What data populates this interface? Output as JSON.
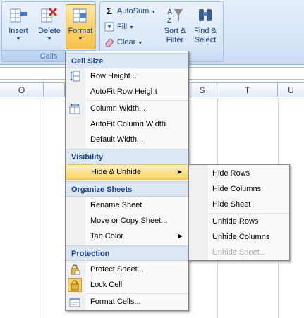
{
  "ribbon": {
    "cells_group": {
      "label": "Cells",
      "insert_label": "Insert",
      "delete_label": "Delete",
      "format_label": "Format"
    },
    "editing_group": {
      "autosum_label": "AutoSum",
      "fill_label": "Fill",
      "clear_label": "Clear",
      "sort_label_1": "Sort &",
      "sort_label_2": "Filter",
      "find_label_1": "Find &",
      "find_label_2": "Select"
    }
  },
  "columns": [
    "O",
    "S",
    "T",
    "U"
  ],
  "format_menu": {
    "sections": {
      "cell_size": "Cell Size",
      "visibility": "Visibility",
      "organize": "Organize Sheets",
      "protection": "Protection"
    },
    "items": {
      "row_height": "Row Height...",
      "autofit_row": "AutoFit Row Height",
      "column_width": "Column Width...",
      "autofit_column": "AutoFit Column Width",
      "default_width": "Default Width...",
      "hide_unhide": "Hide & Unhide",
      "rename_sheet": "Rename Sheet",
      "move_copy": "Move or Copy Sheet...",
      "tab_color": "Tab Color",
      "protect_sheet": "Protect Sheet...",
      "lock_cell": "Lock Cell",
      "format_cells": "Format Cells..."
    }
  },
  "hide_submenu": {
    "hide_rows": "Hide Rows",
    "hide_columns": "Hide Columns",
    "hide_sheet": "Hide Sheet",
    "unhide_rows": "Unhide Rows",
    "unhide_columns": "Unhide Columns",
    "unhide_sheet": "Unhide Sheet..."
  },
  "colors": {
    "accent": "#15428b",
    "highlight": "#fde28c",
    "section_header": "#dde7f3"
  }
}
